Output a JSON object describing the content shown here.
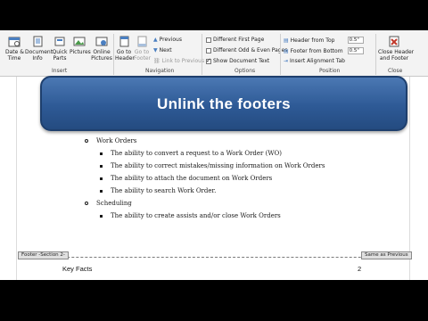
{
  "ribbon": {
    "date_time": "Date &\nTime",
    "document_info": "Document\nInfo",
    "quick_parts": "Quick\nParts",
    "pictures": "Pictures",
    "online_pictures": "Online\nPictures",
    "go_to_header": "Go to\nHeader",
    "go_to_footer": "Go to\nFooter",
    "previous": "Previous",
    "next": "Next",
    "link_to_previous": "Link to Previous",
    "different_first_page": "Different First Page",
    "different_odd_even": "Different Odd & Even Pages",
    "show_document_text": "Show Document Text",
    "header_from_top": "Header from Top",
    "header_from_top_value": "0.5\"",
    "footer_from_bottom": "Footer from Bottom",
    "footer_from_bottom_value": "0.5\"",
    "insert_alignment_tab": "Insert Alignment Tab",
    "close_header_footer": "Close Header\nand Footer",
    "group_insert": "Insert",
    "group_navigation": "Navigation",
    "group_options": "Options",
    "group_position": "Position",
    "group_close": "Close"
  },
  "banner": {
    "text": "Unlink the footers"
  },
  "document": {
    "bullets": [
      {
        "level": 2,
        "text": "Work Orders"
      },
      {
        "level": 3,
        "text": "The ability to convert a request to a Work Order (WO)"
      },
      {
        "level": 3,
        "text": "The ability to correct mistakes/missing information on Work Orders"
      },
      {
        "level": 3,
        "text": "The ability to attach the document on Work Orders"
      },
      {
        "level": 3,
        "text": "The ability to search Work Order."
      },
      {
        "level": 2,
        "text": "Scheduling"
      },
      {
        "level": 3,
        "text": "The ability to create assists and/or close Work Orders"
      }
    ]
  },
  "footer": {
    "tag": "Footer -Section 2-",
    "same_as_previous": "Same as Previous",
    "text": "Key Facts",
    "page": "2"
  },
  "colors": {
    "banner": "#2e5a96",
    "ribbon": "#f3f3f3",
    "page": "#ffffff"
  }
}
